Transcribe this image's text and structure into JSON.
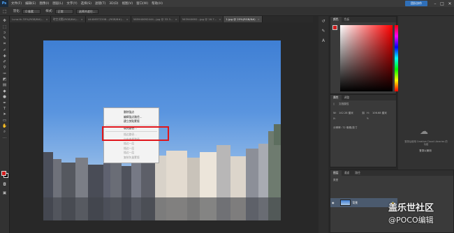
{
  "app": {
    "logo": "Ps",
    "cloud_button": "团队协作"
  },
  "menu": [
    "文件(F)",
    "编辑(E)",
    "图像(I)",
    "图层(L)",
    "文字(Y)",
    "选择(S)",
    "滤镜(T)",
    "3D(D)",
    "视图(V)",
    "窗口(W)",
    "帮助(H)"
  ],
  "options": {
    "feather_label": "羽化:",
    "feather_value": "0 像素",
    "style_label": "样式:",
    "style_value": "正常",
    "refine_button": "选择并遮住..."
  },
  "tabs": [
    {
      "label": "Luna.tk-33%(RGB/8#)...",
      "active": false
    },
    {
      "label": "时空光影(RGB/8#)...",
      "active": false
    },
    {
      "label": "44406572208...(RGB/8#)...",
      "active": false
    },
    {
      "label": "585940692444...jpg @ 33.3...",
      "active": false
    },
    {
      "label": "563940692...jpg @ 16.7...",
      "active": false
    },
    {
      "label": "1.jpg @ 25%(RGB/8#)",
      "active": true
    }
  ],
  "context_menu": {
    "items": [
      {
        "label": "删除锚点",
        "disabled": false
      },
      {
        "label": "编辑锚点路径...",
        "disabled": false
      },
      {
        "label": "建立剪贴蒙版",
        "disabled": false
      },
      {
        "label": "填充路径...",
        "disabled": false
      },
      {
        "label": "描边路径...",
        "disabled": true
      },
      {
        "label": "自由变换路径",
        "disabled": true
      },
      {
        "label": "描边一层",
        "disabled": true
      },
      {
        "label": "描边一层",
        "disabled": true
      },
      {
        "label": "描边一层",
        "disabled": true
      },
      {
        "label": "复制矢量蒙版",
        "disabled": true
      }
    ]
  },
  "color_panel": {
    "tabs": [
      "颜色",
      "色板"
    ]
  },
  "properties_panel": {
    "tabs": [
      "属性",
      "调整"
    ],
    "title": "文档属性",
    "w_label": "W:",
    "w_value": "142.28 厘米",
    "h_label": "H:",
    "h_value": "106.68 厘米",
    "x_label": "X:",
    "y_label": "Y:",
    "res_label": "分辨率: 72 像素/英寸"
  },
  "library_panel": {
    "message": "登录后使用 Creative Cloud Libraries 的功能",
    "button": "登录以使用"
  },
  "layers_panel": {
    "tabs": [
      "图层",
      "通道",
      "路径"
    ],
    "layer_name": "背景",
    "kind_label": "类型"
  },
  "watermark": {
    "line1": "盖乐世社区",
    "line2": "@POCO编辑"
  },
  "colors": {
    "fg": "#d21c1c",
    "bg": "#000000",
    "highlight": "#e0151b",
    "accent": "#2f6fb8"
  }
}
